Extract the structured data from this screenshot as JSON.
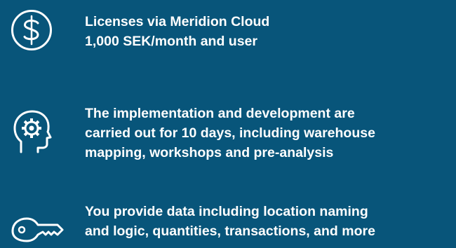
{
  "items": [
    {
      "icon": "dollar-coin-icon",
      "lines": [
        "Licenses via Meridion Cloud",
        "1,000 SEK/month and user"
      ]
    },
    {
      "icon": "head-gear-icon",
      "lines": [
        "The implementation and development are",
        "carried out for 10 days, including warehouse",
        "mapping, workshops and pre-analysis"
      ]
    },
    {
      "icon": "key-icon",
      "lines": [
        "You provide data including location naming",
        "and logic, quantities, transactions, and more"
      ]
    }
  ],
  "colors": {
    "background": "#08557a",
    "text": "#ffffff",
    "icon_stroke": "#ffffff"
  }
}
